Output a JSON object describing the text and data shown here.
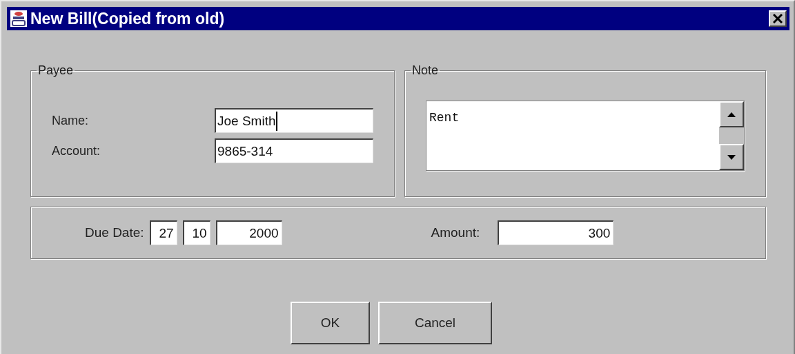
{
  "window": {
    "title": "New Bill(Copied from old)"
  },
  "payee": {
    "title": "Payee",
    "fields": [
      {
        "label": "Name:",
        "value": "Joe Smith",
        "focused": true
      },
      {
        "label": "Account:",
        "value": "9865-314",
        "focused": false
      }
    ]
  },
  "note": {
    "title": "Note",
    "value": "Rent"
  },
  "due_date": {
    "label": "Due Date:",
    "day": "27",
    "month": "10",
    "year": "2000"
  },
  "amount": {
    "label": "Amount:",
    "value": "300"
  },
  "buttons": [
    "OK",
    "Cancel"
  ]
}
